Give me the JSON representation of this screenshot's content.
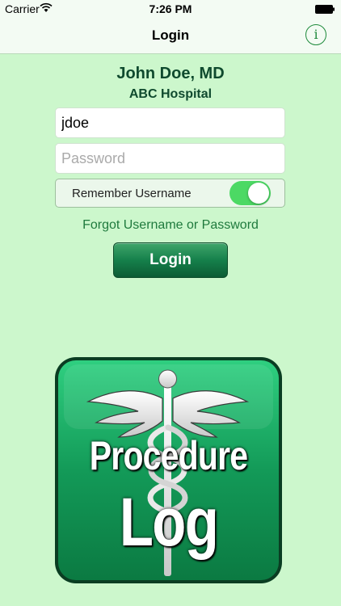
{
  "status_bar": {
    "carrier": "Carrier",
    "time": "7:26 PM"
  },
  "nav": {
    "title": "Login",
    "info_icon": "info-icon"
  },
  "header": {
    "doctor_name": "John Doe, MD",
    "hospital": "ABC Hospital"
  },
  "form": {
    "username_value": "jdoe",
    "password_placeholder": "Password",
    "remember_label": "Remember Username",
    "remember_enabled": true
  },
  "forgot_link": "Forgot Username or Password",
  "login_button": "Login",
  "logo": {
    "line1": "Procedure",
    "line2": "Log"
  },
  "colors": {
    "background": "#ccf7cc",
    "accent": "#1e8a3b",
    "toggle_on": "#4cd964",
    "logo_green": "#139a58"
  }
}
